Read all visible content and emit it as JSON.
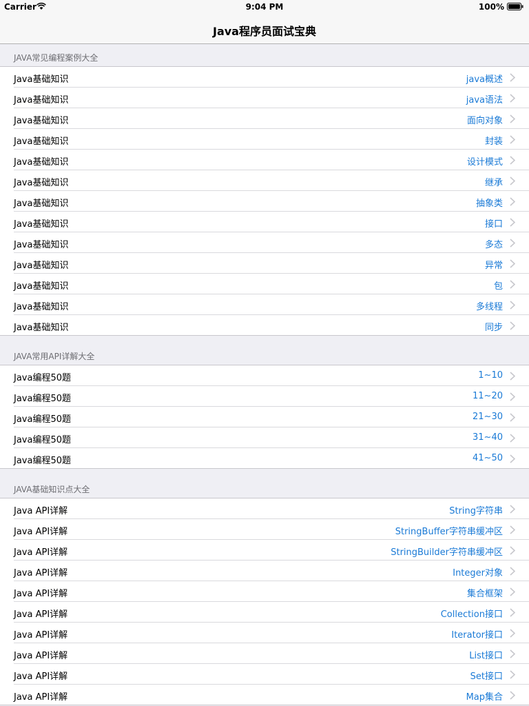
{
  "status": {
    "carrier": "Carrier",
    "time": "9:04 PM",
    "battery": "100%"
  },
  "nav": {
    "title": "Java程序员面试宝典"
  },
  "sections": [
    {
      "header": "JAVA常见编程案例大全",
      "rows": [
        {
          "left": "Java基础知识",
          "right": "java概述"
        },
        {
          "left": "Java基础知识",
          "right": "java语法"
        },
        {
          "left": "Java基础知识",
          "right": "面向对象"
        },
        {
          "left": "Java基础知识",
          "right": "封装"
        },
        {
          "left": "Java基础知识",
          "right": "设计模式"
        },
        {
          "left": "Java基础知识",
          "right": "继承"
        },
        {
          "left": "Java基础知识",
          "right": "抽象类"
        },
        {
          "left": "Java基础知识",
          "right": "接口"
        },
        {
          "left": "Java基础知识",
          "right": "多态"
        },
        {
          "left": "Java基础知识",
          "right": "异常"
        },
        {
          "left": "Java基础知识",
          "right": "包"
        },
        {
          "left": "Java基础知识",
          "right": "多线程"
        },
        {
          "left": "Java基础知识",
          "right": "同步"
        }
      ]
    },
    {
      "header": "JAVA常用API详解大全",
      "rows": [
        {
          "left": "Java编程50题",
          "right": "1~10"
        },
        {
          "left": "Java编程50题",
          "right": "11~20"
        },
        {
          "left": "Java编程50题",
          "right": "21~30"
        },
        {
          "left": "Java编程50题",
          "right": "31~40"
        },
        {
          "left": "Java编程50题",
          "right": "41~50"
        }
      ]
    },
    {
      "header": "JAVA基础知识点大全",
      "rows": [
        {
          "left": "Java API详解",
          "right": "String字符串"
        },
        {
          "left": "Java API详解",
          "right": "StringBuffer字符串缓冲区"
        },
        {
          "left": "Java API详解",
          "right": "StringBuilder字符串缓冲区"
        },
        {
          "left": "Java API详解",
          "right": "Integer对象"
        },
        {
          "left": "Java API详解",
          "right": "集合框架"
        },
        {
          "left": "Java API详解",
          "right": "Collection接口"
        },
        {
          "left": "Java API详解",
          "right": "Iterator接口"
        },
        {
          "left": "Java API详解",
          "right": "List接口"
        },
        {
          "left": "Java API详解",
          "right": "Set接口"
        },
        {
          "left": "Java API详解",
          "right": "Map集合"
        }
      ]
    }
  ]
}
